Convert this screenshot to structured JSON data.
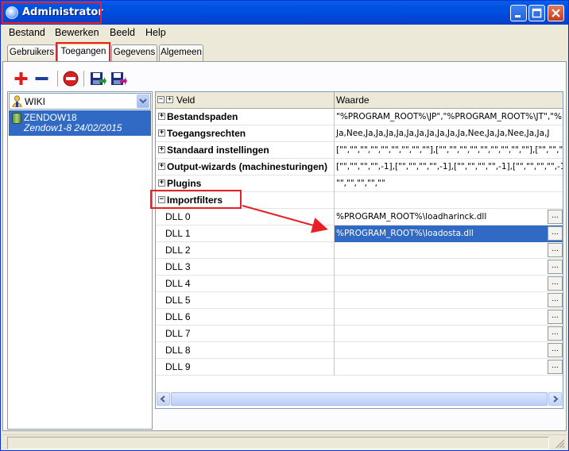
{
  "window": {
    "title": "Administrator"
  },
  "titlebar": {
    "minimize": "_",
    "maximize": "□",
    "close": "✕"
  },
  "menu": [
    {
      "label": "Bestand"
    },
    {
      "label": "Bewerken"
    },
    {
      "label": "Beeld"
    },
    {
      "label": "Help"
    }
  ],
  "tabs": [
    {
      "label": "Gebruikers",
      "active": false
    },
    {
      "label": "Toegangen",
      "active": true
    },
    {
      "label": "Gegevens",
      "active": false
    },
    {
      "label": "Algemeen",
      "active": false
    }
  ],
  "toolbar": {
    "icons": [
      "add-icon",
      "remove-icon",
      "delete-icon",
      "save-icon",
      "save-as-icon"
    ]
  },
  "left_panel": {
    "combo_value": "WIKI",
    "database": {
      "name": "ZENDOW18",
      "detail": "Zendow1-8 24/02/2015"
    }
  },
  "grid": {
    "headers": {
      "field": "Veld",
      "value": "Waarde"
    },
    "groups": [
      {
        "label": "Bestandspaden",
        "value": "\"%PROGRAM_ROOT%\\JP\",\"%PROGRAM_ROOT%\\JT\",\"%"
      },
      {
        "label": "Toegangsrechten",
        "value": "Ja,Nee,Ja,Ja,Ja,Ja,Ja,Ja,Ja,Ja,Ja,Ja,Nee,Ja,Ja,Nee,Ja,Ja,J"
      },
      {
        "label": "Standaard instellingen",
        "value": "[\"\",\"\",\"\",\"\",\"\",\"\",\"\",\"\",\"\"],[\"\",\"\",\"\",\"\",\"\",\"\",\"\",\"\",\"\"],[\"\",\"\",\"\",\"\",\"\",\"\",\"\",\"\",\"\"],[\"\","
      },
      {
        "label": "Output-wizards (machinesturingen)",
        "value": "[\"\",\"\",\"\",\"\",-1],[\"\",\"\",\"\",\"\",-1],[\"\",\"\",\"\",\"\",-1],[\"\",\"\",\"\",\"\",-1],[\"\",\"\",\"\",\"\",-1],"
      },
      {
        "label": "Plugins",
        "value": "\"\",\"\",\"\",\"\",\"\""
      },
      {
        "label": "Importfilters",
        "value": ""
      }
    ],
    "dll_rows": [
      {
        "label": "DLL 0",
        "value": "%PROGRAM_ROOT%\\loadharinck.dll"
      },
      {
        "label": "DLL 1",
        "value": "%PROGRAM_ROOT%\\loadosta.dll"
      },
      {
        "label": "DLL 2",
        "value": ""
      },
      {
        "label": "DLL 3",
        "value": ""
      },
      {
        "label": "DLL 4",
        "value": ""
      },
      {
        "label": "DLL 5",
        "value": ""
      },
      {
        "label": "DLL 6",
        "value": ""
      },
      {
        "label": "DLL 7",
        "value": ""
      },
      {
        "label": "DLL 8",
        "value": ""
      },
      {
        "label": "DLL 9",
        "value": ""
      }
    ],
    "ellipsis": "..."
  },
  "colors": {
    "selection": "#316ac5",
    "annotation": "#e8202a",
    "titlebar": "#0054e3"
  }
}
